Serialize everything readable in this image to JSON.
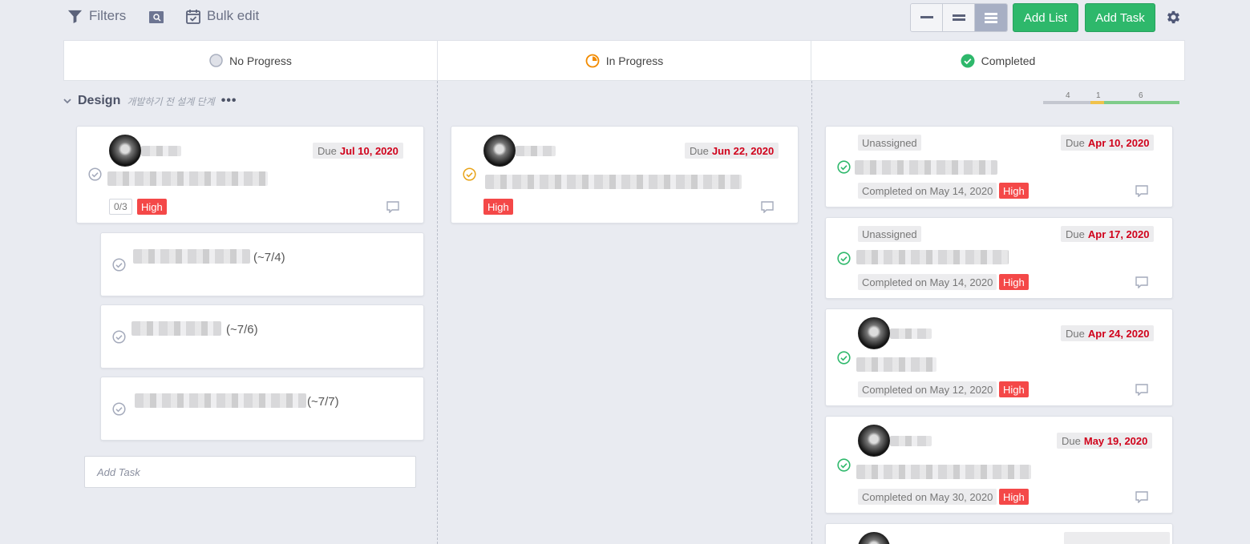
{
  "toolbar": {
    "filters_label": "Filters",
    "bulk_edit_label": "Bulk edit",
    "add_list_label": "Add List",
    "add_task_label": "Add Task"
  },
  "columns": [
    {
      "label": "No Progress"
    },
    {
      "label": "In Progress"
    },
    {
      "label": "Completed"
    }
  ],
  "group": {
    "name": "Design",
    "description": "개발하기 전 설계 단계",
    "more": "•••"
  },
  "progress_counts": {
    "no_progress": "4",
    "in_progress": "1",
    "completed": "6",
    "colors": {
      "no_progress": "#c4c7d0",
      "in_progress": "#f0c24b",
      "completed": "#7fcc8a"
    }
  },
  "no_progress_column": {
    "task": {
      "due_prefix": "Due",
      "due_date": "Jul 10, 2020",
      "subtask_count": "0/3",
      "priority": "High"
    },
    "subtasks": [
      {
        "suffix": "(~7/4)"
      },
      {
        "suffix": "(~7/6)"
      },
      {
        "suffix": "(~7/7)"
      }
    ],
    "add_task_placeholder": "Add Task"
  },
  "in_progress_column": {
    "task": {
      "due_prefix": "Due",
      "due_date": "Jun 22, 2020",
      "priority": "High"
    }
  },
  "completed_column": {
    "tasks": [
      {
        "assignee": "Unassigned",
        "due_prefix": "Due",
        "due_date": "Apr 10, 2020",
        "completed": "Completed on May 14, 2020",
        "priority": "High"
      },
      {
        "assignee": "Unassigned",
        "due_prefix": "Due",
        "due_date": "Apr 17, 2020",
        "completed": "Completed on May 14, 2020",
        "priority": "High"
      },
      {
        "due_prefix": "Due",
        "due_date": "Apr 24, 2020",
        "completed": "Completed on May 12, 2020",
        "priority": "High"
      },
      {
        "due_prefix": "Due",
        "due_date": "May 19, 2020",
        "completed": "Completed on May 30, 2020",
        "priority": "High"
      }
    ]
  }
}
